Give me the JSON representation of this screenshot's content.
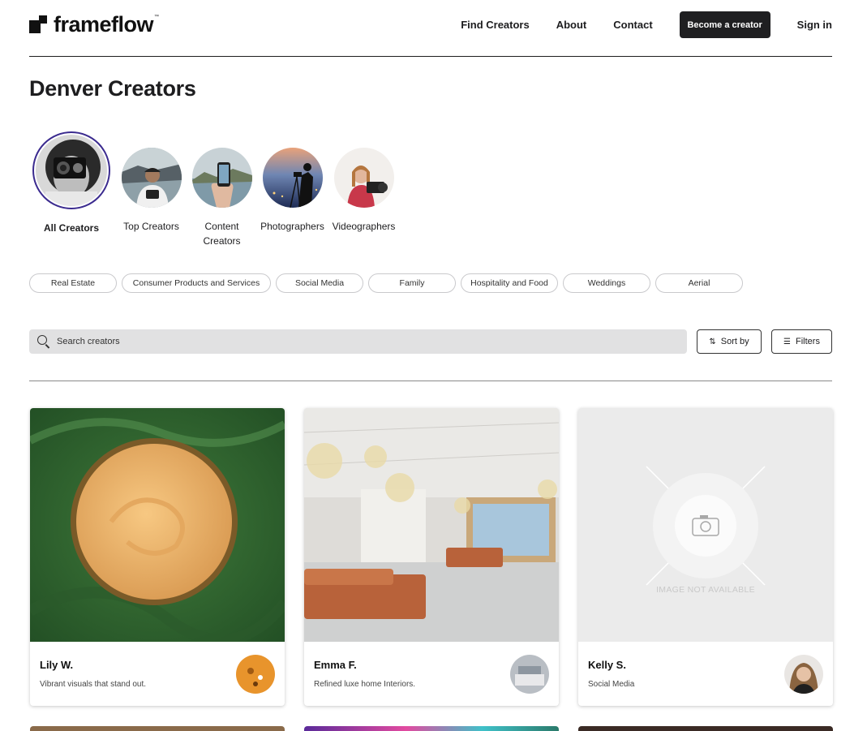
{
  "brand": {
    "name": "frameflow",
    "tm": "™"
  },
  "nav": {
    "find_creators": "Find Creators",
    "about": "About",
    "contact": "Contact",
    "become_creator": "Become a creator",
    "sign_in": "Sign in"
  },
  "page": {
    "title": "Denver Creators"
  },
  "categories": [
    {
      "label": "All Creators",
      "active": true
    },
    {
      "label": "Top Creators",
      "active": false
    },
    {
      "label": "Content Creators",
      "active": false
    },
    {
      "label": "Photographers",
      "active": false
    },
    {
      "label": "Videographers",
      "active": false
    }
  ],
  "chips": [
    "Real Estate",
    "Consumer Products and Services",
    "Social Media",
    "Family",
    "Hospitality and Food",
    "Weddings",
    "Aerial"
  ],
  "search": {
    "placeholder": "Search creators"
  },
  "toolbar": {
    "sort_label": "Sort by",
    "filters_label": "Filters"
  },
  "creators": [
    {
      "name": "Lily W.",
      "description": "Vibrant visuals that stand out."
    },
    {
      "name": "Emma F.",
      "description": "Refined luxe home Interiors."
    },
    {
      "name": "Kelly S.",
      "description": "Social Media",
      "image_placeholder": "IMAGE NOT AVAILABLE"
    }
  ],
  "colors": {
    "accent": "#3b2b8f",
    "dark_button": "#1f1f21",
    "search_bg": "#e1e1e2"
  }
}
